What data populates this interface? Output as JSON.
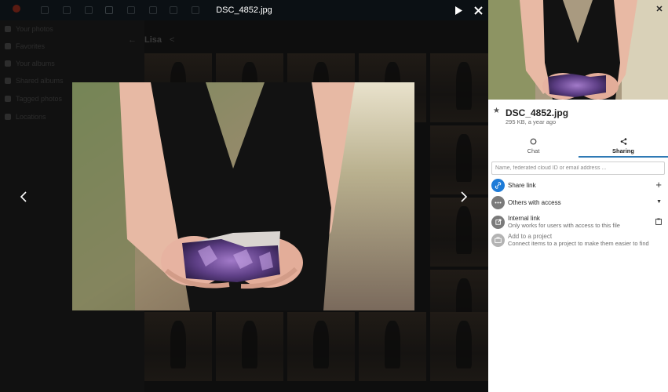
{
  "viewer": {
    "title": "DSC_4852.jpg"
  },
  "background": {
    "sidebar_items": [
      "Your photos",
      "Favorites",
      "Your albums",
      "Shared albums",
      "Tagged photos",
      "Locations"
    ],
    "breadcrumb": "Lisa"
  },
  "panel": {
    "file_name": "DSC_4852.jpg",
    "file_meta": "295 KB, a year ago",
    "tabs": [
      {
        "label": "Chat",
        "icon": "chat-icon"
      },
      {
        "label": "Sharing",
        "icon": "share-icon",
        "active": true
      }
    ],
    "share_input_placeholder": "Name, federated cloud ID or email address ...",
    "share_link_label": "Share link",
    "others_label": "Others with access",
    "internal_link_label": "Internal link",
    "internal_link_sub": "Only works for users with access to this file",
    "project_label": "Add to a project",
    "project_sub": "Connect items to a project to make them easier to find"
  },
  "colors": {
    "accent": "#2f7ab5",
    "share_link_bg": "#1d7bd8",
    "grey_icon_bg": "#7a7a7a",
    "project_icon_bg": "#b3b3b3"
  }
}
